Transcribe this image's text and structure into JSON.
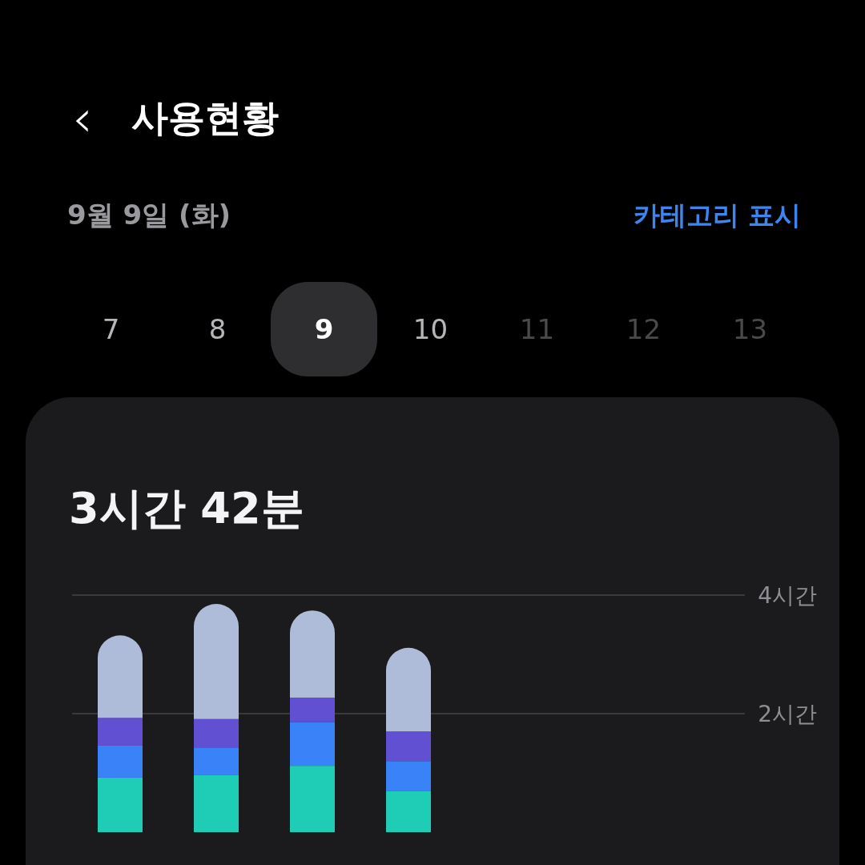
{
  "header": {
    "back_icon": "‹",
    "title": "사용현황"
  },
  "date_row": {
    "date": "9월 9일 (화)",
    "category_link": "카테고리 표시"
  },
  "days": [
    {
      "label": "7",
      "selected": false,
      "disabled": false
    },
    {
      "label": "8",
      "selected": false,
      "disabled": false
    },
    {
      "label": "9",
      "selected": true,
      "disabled": false
    },
    {
      "label": "10",
      "selected": false,
      "disabled": false
    },
    {
      "label": "11",
      "selected": false,
      "disabled": true
    },
    {
      "label": "12",
      "selected": false,
      "disabled": true
    },
    {
      "label": "13",
      "selected": false,
      "disabled": true
    }
  ],
  "usage_card": {
    "total": "3시간 42분",
    "chart_data": {
      "type": "bar",
      "stacked": true,
      "ylim": [
        0,
        4
      ],
      "yticks": [
        {
          "value": 2,
          "label": "2시간"
        },
        {
          "value": 4,
          "label": "4시간"
        }
      ],
      "series": [
        {
          "color": "#1fcdb6",
          "values": [
            0.92,
            0.96,
            1.12,
            0.69,
            null,
            null,
            null
          ]
        },
        {
          "color": "#3a82f7",
          "values": [
            0.54,
            0.47,
            0.74,
            0.51,
            null,
            null,
            null
          ]
        },
        {
          "color": "#6250d2",
          "values": [
            0.47,
            0.48,
            0.41,
            0.5,
            null,
            null,
            null
          ]
        },
        {
          "color": "#aebcd9",
          "values": [
            1.39,
            1.94,
            1.47,
            1.41,
            null,
            null,
            null
          ]
        }
      ]
    }
  }
}
